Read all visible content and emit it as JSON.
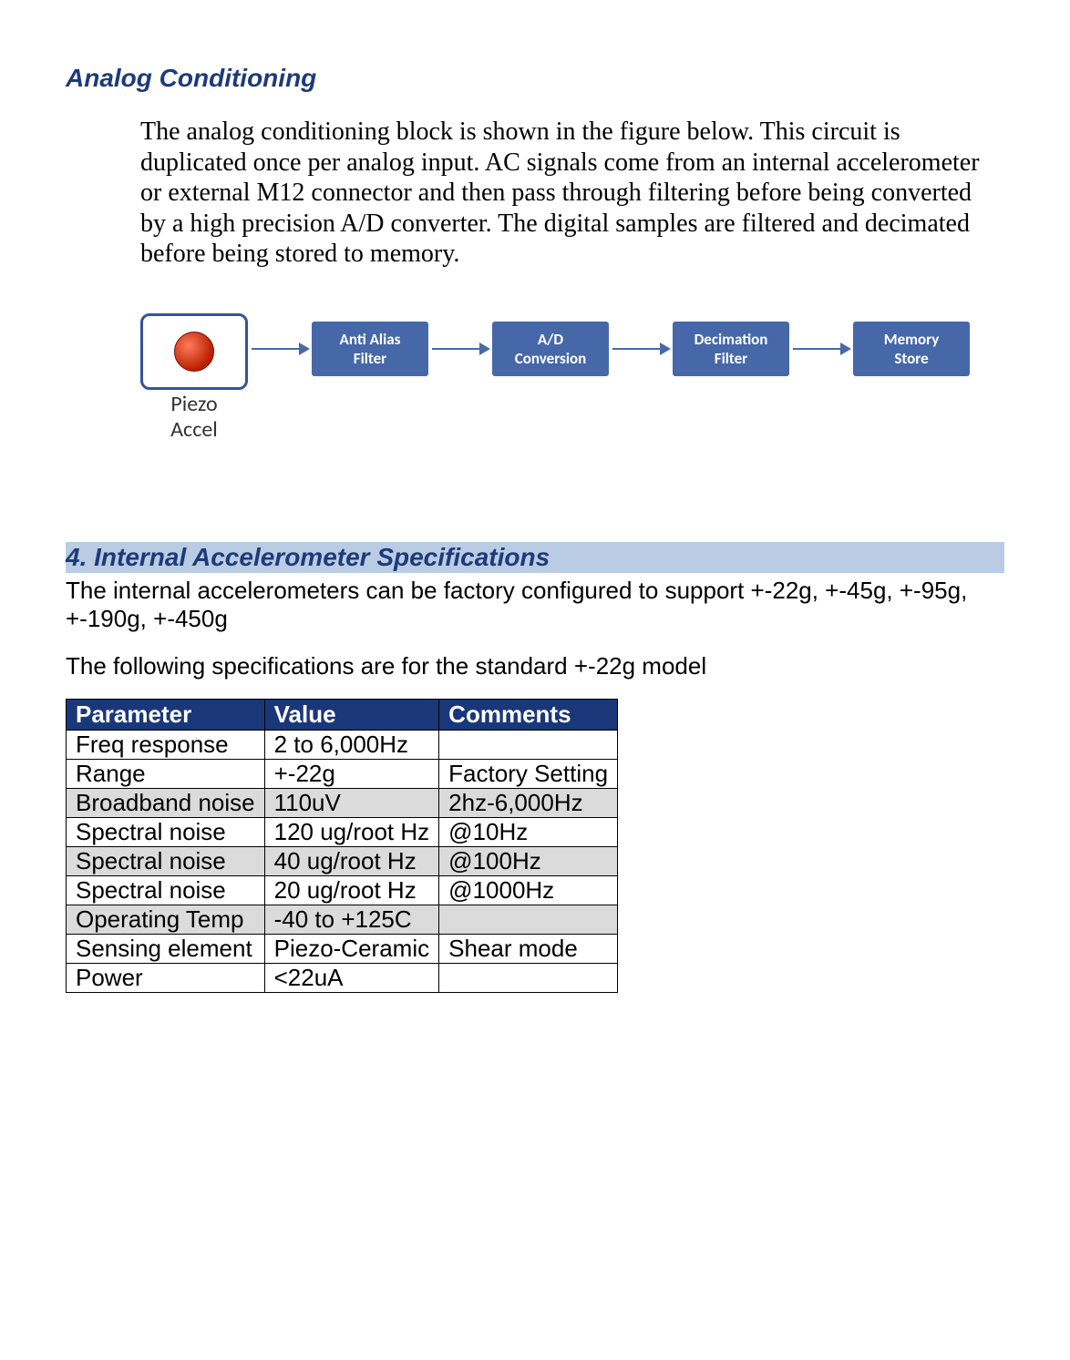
{
  "section1": {
    "title": "Analog Conditioning",
    "para": "The analog conditioning block is shown in the figure below. This circuit is duplicated once per analog input.  AC signals come from an internal accelerometer or external M12 connector and then pass through filtering before being converted by a high precision A/D converter. The digital samples are filtered and decimated before being stored to memory."
  },
  "diagram": {
    "piezo_label": "Piezo\nAccel",
    "blocks": [
      "Anti Alias\nFilter",
      "A/D\nConversion",
      "Decimation\nFilter",
      "Memory\nStore"
    ]
  },
  "section2": {
    "title": "4.  Internal Accelerometer Specifications",
    "para1": "The internal accelerometers can be factory configured to support +-22g, +-45g, +-95g, +-190g, +-450g",
    "para2": "The following specifications are for the standard +-22g model"
  },
  "table": {
    "headers": [
      "Parameter",
      "Value",
      "Comments"
    ],
    "rows": [
      {
        "alt": false,
        "c": [
          "Freq response",
          "2 to 6,000Hz",
          ""
        ]
      },
      {
        "alt": false,
        "c": [
          "Range",
          "+-22g",
          "Factory Setting"
        ]
      },
      {
        "alt": true,
        "c": [
          "Broadband noise",
          "110uV",
          "2hz-6,000Hz"
        ]
      },
      {
        "alt": false,
        "c": [
          "Spectral noise",
          "120 ug/root Hz",
          "@10Hz"
        ]
      },
      {
        "alt": true,
        "c": [
          "Spectral noise",
          "40 ug/root Hz",
          "@100Hz"
        ]
      },
      {
        "alt": false,
        "c": [
          "Spectral noise",
          "20 ug/root Hz",
          "@1000Hz"
        ]
      },
      {
        "alt": true,
        "c": [
          "Operating Temp",
          "-40 to +125C",
          ""
        ]
      },
      {
        "alt": false,
        "c": [
          "Sensing element",
          "Piezo-Ceramic",
          "Shear mode"
        ]
      },
      {
        "alt": false,
        "c": [
          "Power",
          "<22uA",
          ""
        ]
      }
    ]
  }
}
